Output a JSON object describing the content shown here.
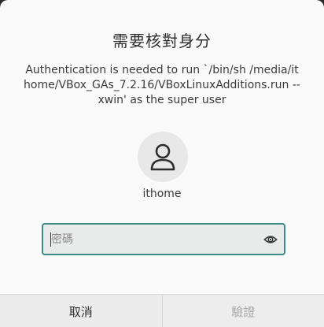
{
  "dialog": {
    "title": "需要核對身分",
    "message": "Authentication is needed to run `/bin/sh /media/ithome/VBox_GAs_7.2.16/VBoxLinuxAdditions.run --xwin' as the super user",
    "username": "ithome",
    "password_placeholder": "密碼",
    "password_value": "",
    "cancel_label": "取消",
    "verify_label": "驗證",
    "icons": {
      "avatar": "user-icon",
      "reveal": "eye-icon"
    },
    "colors": {
      "accent": "#3b8a86",
      "background": "#fafafa",
      "button_bar": "#ececec",
      "disabled_text": "#a8a8a8"
    }
  }
}
